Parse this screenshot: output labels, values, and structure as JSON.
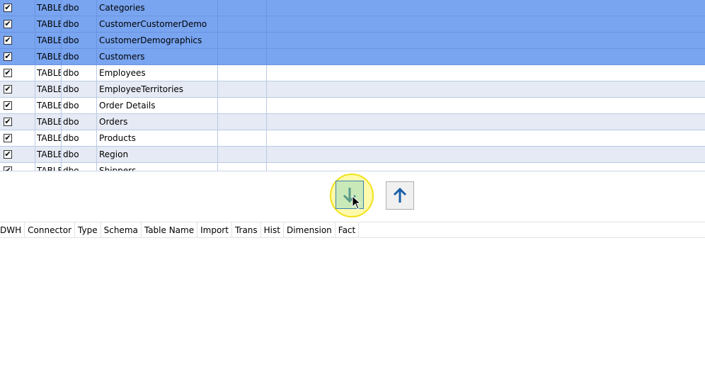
{
  "source_table": {
    "rows": [
      {
        "checked": true,
        "check_glyph": "✔",
        "type": "TABLE",
        "schema": "dbo",
        "name": "Categories",
        "selected": true
      },
      {
        "checked": true,
        "check_glyph": "✔",
        "type": "TABLE",
        "schema": "dbo",
        "name": "CustomerCustomerDemo",
        "selected": true
      },
      {
        "checked": true,
        "check_glyph": "✔",
        "type": "TABLE",
        "schema": "dbo",
        "name": "CustomerDemographics",
        "selected": true
      },
      {
        "checked": true,
        "check_glyph": "✔",
        "type": "TABLE",
        "schema": "dbo",
        "name": "Customers",
        "selected": true
      },
      {
        "checked": true,
        "check_glyph": "✔",
        "type": "TABLE",
        "schema": "dbo",
        "name": "Employees",
        "selected": false
      },
      {
        "checked": true,
        "check_glyph": "✔",
        "type": "TABLE",
        "schema": "dbo",
        "name": "EmployeeTerritories",
        "selected": false
      },
      {
        "checked": true,
        "check_glyph": "✔",
        "type": "TABLE",
        "schema": "dbo",
        "name": "Order Details",
        "selected": false
      },
      {
        "checked": true,
        "check_glyph": "✔",
        "type": "TABLE",
        "schema": "dbo",
        "name": "Orders",
        "selected": false
      },
      {
        "checked": true,
        "check_glyph": "✔",
        "type": "TABLE",
        "schema": "dbo",
        "name": "Products",
        "selected": false
      },
      {
        "checked": true,
        "check_glyph": "✔",
        "type": "TABLE",
        "schema": "dbo",
        "name": "Region",
        "selected": false
      },
      {
        "checked": true,
        "check_glyph": "✔",
        "type": "TABLE",
        "schema": "dbo",
        "name": "Shippers",
        "selected": false
      }
    ]
  },
  "actions": {
    "move_down_icon": "arrow-down-icon",
    "move_up_icon": "arrow-up-icon"
  },
  "target_table": {
    "columns": [
      "DWH",
      "Connector",
      "Type",
      "Schema",
      "Table Name",
      "Import",
      "Trans",
      "Hist",
      "Dimension",
      "Fact"
    ]
  },
  "colors": {
    "selection": "#78a4f0",
    "alt_row": "#e6eaf4",
    "down_button_bg": "#c9e9b9",
    "up_arrow": "#1a5fa8",
    "down_arrow": "#5a9a88",
    "highlight": "#f2e21a"
  }
}
